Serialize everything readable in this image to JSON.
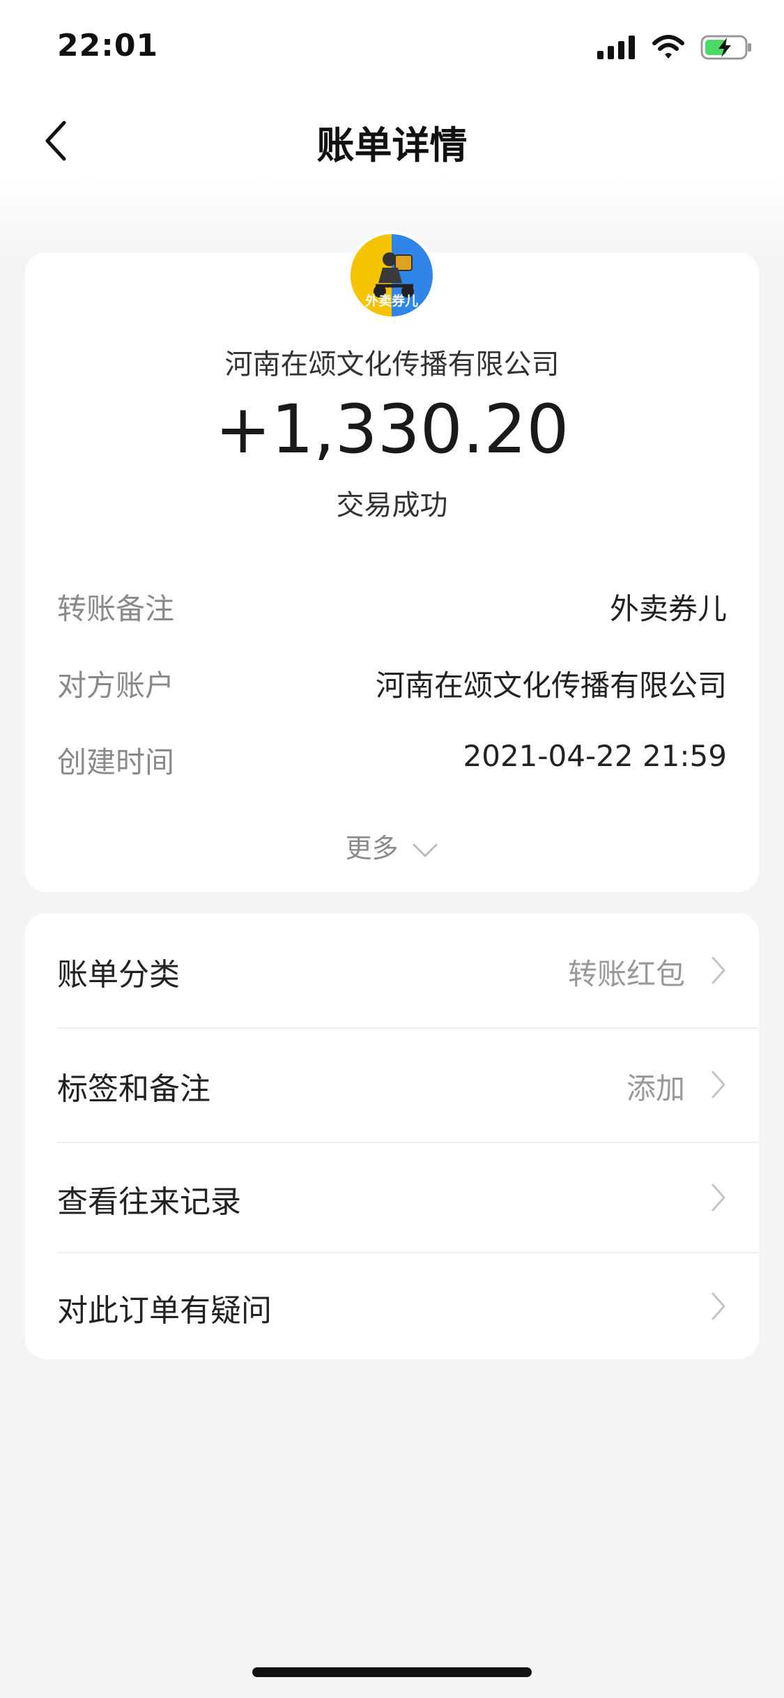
{
  "status_bar": {
    "time": "22:01"
  },
  "nav": {
    "title": "账单详情"
  },
  "transaction": {
    "avatar_text": "外卖券儿",
    "merchant": "河南在颂文化传播有限公司",
    "amount": "+1,330.20",
    "status": "交易成功"
  },
  "details": [
    {
      "label": "转账备注",
      "value": "外卖券儿"
    },
    {
      "label": "对方账户",
      "value": "河南在颂文化传播有限公司"
    },
    {
      "label": "创建时间",
      "value": "2021-04-22 21:59"
    }
  ],
  "more_label": "更多",
  "list": [
    {
      "label": "账单分类",
      "value": "转账红包"
    },
    {
      "label": "标签和备注",
      "value": "添加"
    },
    {
      "label": "查看往来记录",
      "value": ""
    },
    {
      "label": "对此订单有疑问",
      "value": ""
    }
  ],
  "watermark": "",
  "colors": {
    "accent_yellow": "#f5c300",
    "accent_blue": "#2f86e8",
    "background": "#f4f4f4"
  }
}
